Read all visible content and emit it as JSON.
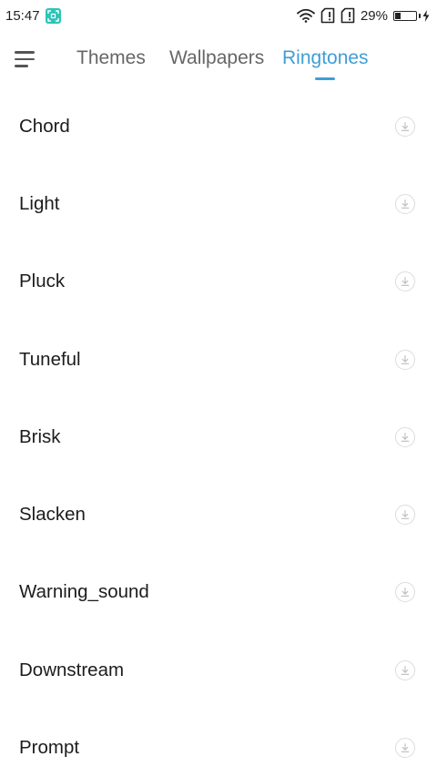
{
  "status_bar": {
    "time": "15:47",
    "battery_percent_label": "29%",
    "battery_level": 0.29
  },
  "tabs": [
    {
      "label": "Themes",
      "active": false
    },
    {
      "label": "Wallpapers",
      "active": false
    },
    {
      "label": "Ringtones",
      "active": true
    }
  ],
  "ringtones": [
    {
      "name": "Chord"
    },
    {
      "name": "Light"
    },
    {
      "name": "Pluck"
    },
    {
      "name": "Tuneful"
    },
    {
      "name": "Brisk"
    },
    {
      "name": "Slacken"
    },
    {
      "name": "Warning_sound"
    },
    {
      "name": "Downstream"
    },
    {
      "name": "Prompt"
    }
  ],
  "colors": {
    "accent": "#3f9ed6",
    "text": "#1c1c1c",
    "inactive_tab": "#666666",
    "app_badge": "#2ec4b6"
  },
  "icons": {
    "menu": "hamburger-menu-icon",
    "download": "download-icon",
    "wifi": "wifi-icon",
    "sim": "sim-card-icon",
    "battery": "battery-icon",
    "charging": "charging-bolt-icon"
  }
}
